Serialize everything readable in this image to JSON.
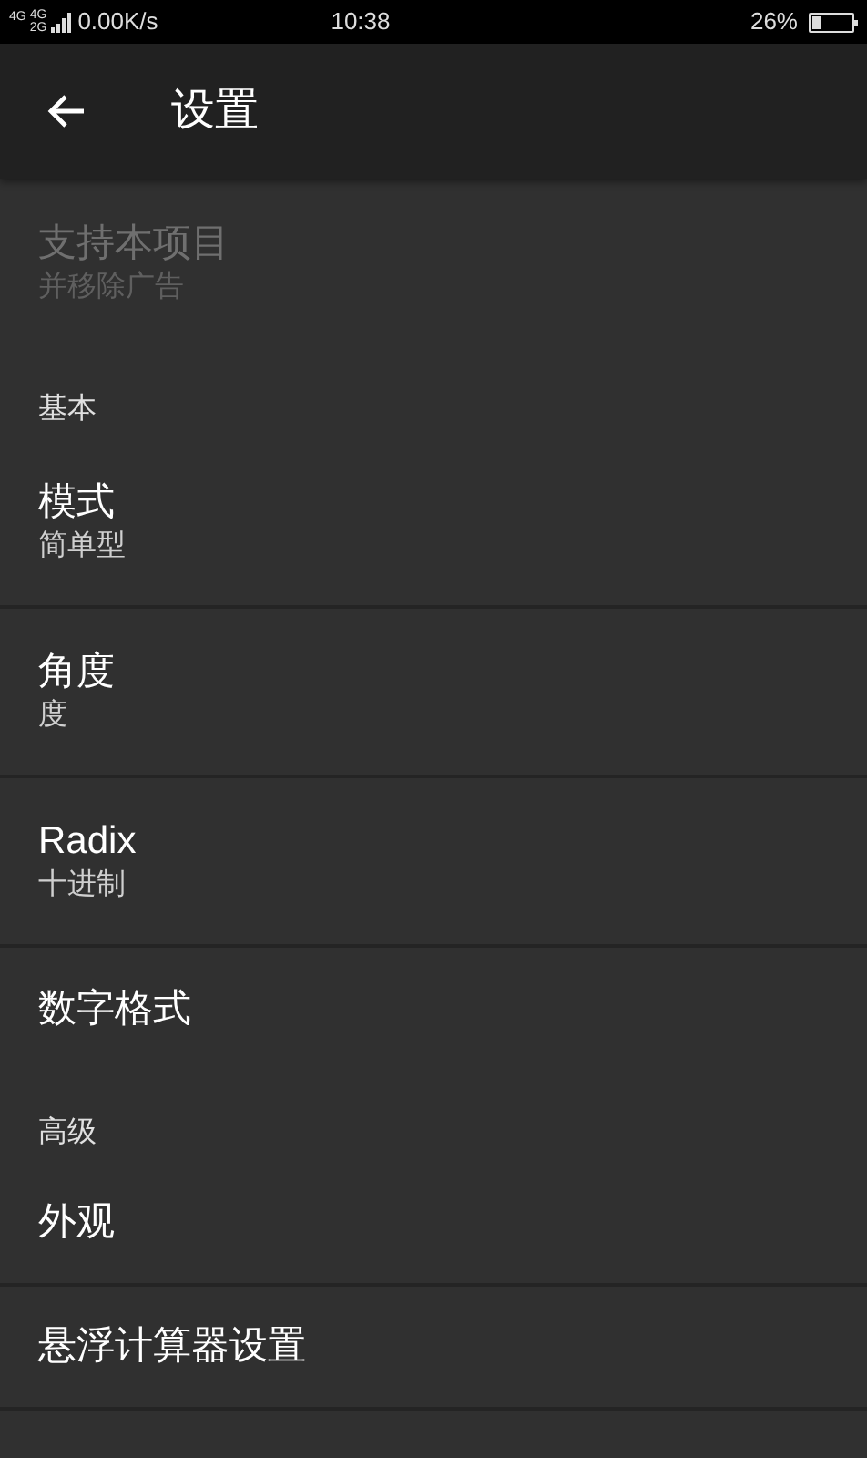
{
  "status_bar": {
    "network": [
      "4G",
      "4G",
      "2G"
    ],
    "speed": "0.00K/s",
    "time": "10:38",
    "battery": "26%"
  },
  "app_bar": {
    "title": "设置"
  },
  "items": [
    {
      "kind": "preference",
      "title": "支持本项目",
      "summary": "并移除广告",
      "disabled": true,
      "divider": false
    },
    {
      "kind": "category",
      "title": "基本"
    },
    {
      "kind": "preference",
      "title": "模式",
      "summary": "简单型",
      "disabled": false,
      "divider": true
    },
    {
      "kind": "preference",
      "title": "角度",
      "summary": "度",
      "disabled": false,
      "divider": true
    },
    {
      "kind": "preference",
      "title": "Radix",
      "summary": "十进制",
      "disabled": false,
      "divider": true
    },
    {
      "kind": "preference",
      "title": "数字格式",
      "disabled": false,
      "divider": false
    },
    {
      "kind": "category",
      "title": "高级"
    },
    {
      "kind": "preference",
      "title": "外观",
      "disabled": false,
      "divider": true
    },
    {
      "kind": "preference",
      "title": "悬浮计算器设置",
      "disabled": false,
      "divider": true
    }
  ]
}
